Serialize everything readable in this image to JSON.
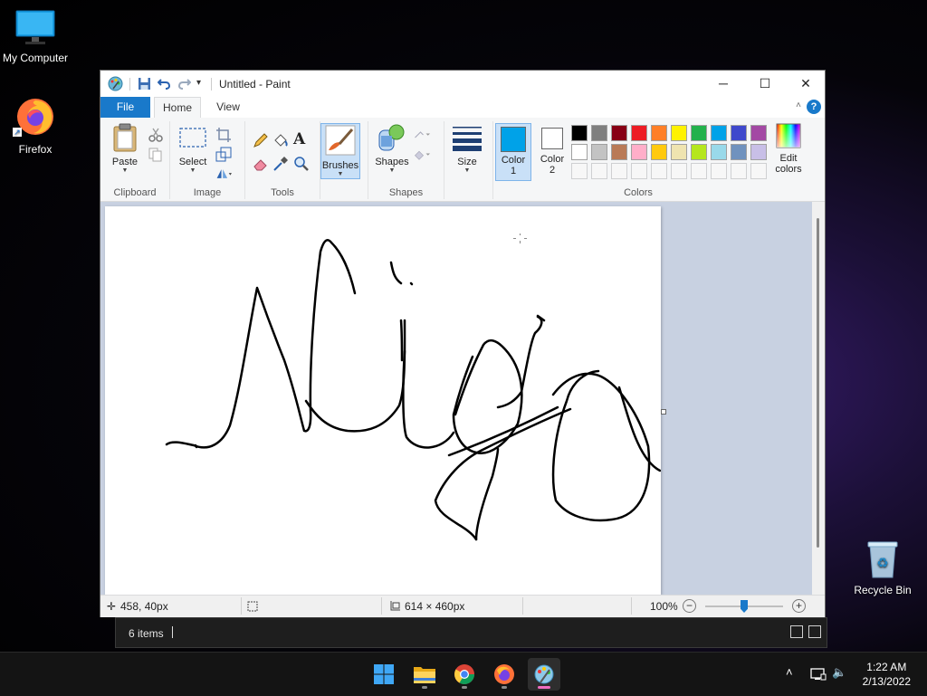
{
  "desktop": {
    "icons": [
      {
        "label": "My Computer"
      },
      {
        "label": "Firefox"
      },
      {
        "label": "Recycle Bin"
      }
    ]
  },
  "explorer": {
    "items_text": "6 items"
  },
  "paint": {
    "title": "Untitled - Paint",
    "tabs": [
      "File",
      "Home",
      "View"
    ],
    "help": "?",
    "groups": {
      "clipboard": {
        "label": "Clipboard",
        "paste": "Paste"
      },
      "image": {
        "label": "Image",
        "select": "Select"
      },
      "tools": {
        "label": "Tools"
      },
      "brushes": {
        "label": "Brushes"
      },
      "shapes": {
        "label": "Shapes",
        "shapes_btn": "Shapes"
      },
      "size": {
        "label": "Size"
      },
      "colors": {
        "label": "Colors",
        "color1": "Color 1",
        "color2": "Color 2",
        "edit": "Edit colors",
        "color1_value": "#00a2e8",
        "color2_value": "#ffffff",
        "palette_row1": [
          "#000000",
          "#7f7f7f",
          "#880015",
          "#ed1c24",
          "#ff7f27",
          "#fff200",
          "#22b14c",
          "#00a2e8",
          "#3f48cc",
          "#a349a4"
        ],
        "palette_row2": [
          "#ffffff",
          "#c3c3c3",
          "#b97a57",
          "#ffaec9",
          "#ffc90e",
          "#efe4b0",
          "#b5e61d",
          "#99d9ea",
          "#7092be",
          "#c8bfe7"
        ]
      }
    },
    "status": {
      "cursor_pos": "458, 40px",
      "canvas_size": "614 × 460px",
      "zoom": "100%",
      "zoom_level": 0.5
    }
  },
  "taskbar": {
    "time": "1:22 AM",
    "date": "2/13/2022",
    "apps": [
      "start-button",
      "file-explorer",
      "chrome",
      "firefox",
      "paint"
    ]
  }
}
